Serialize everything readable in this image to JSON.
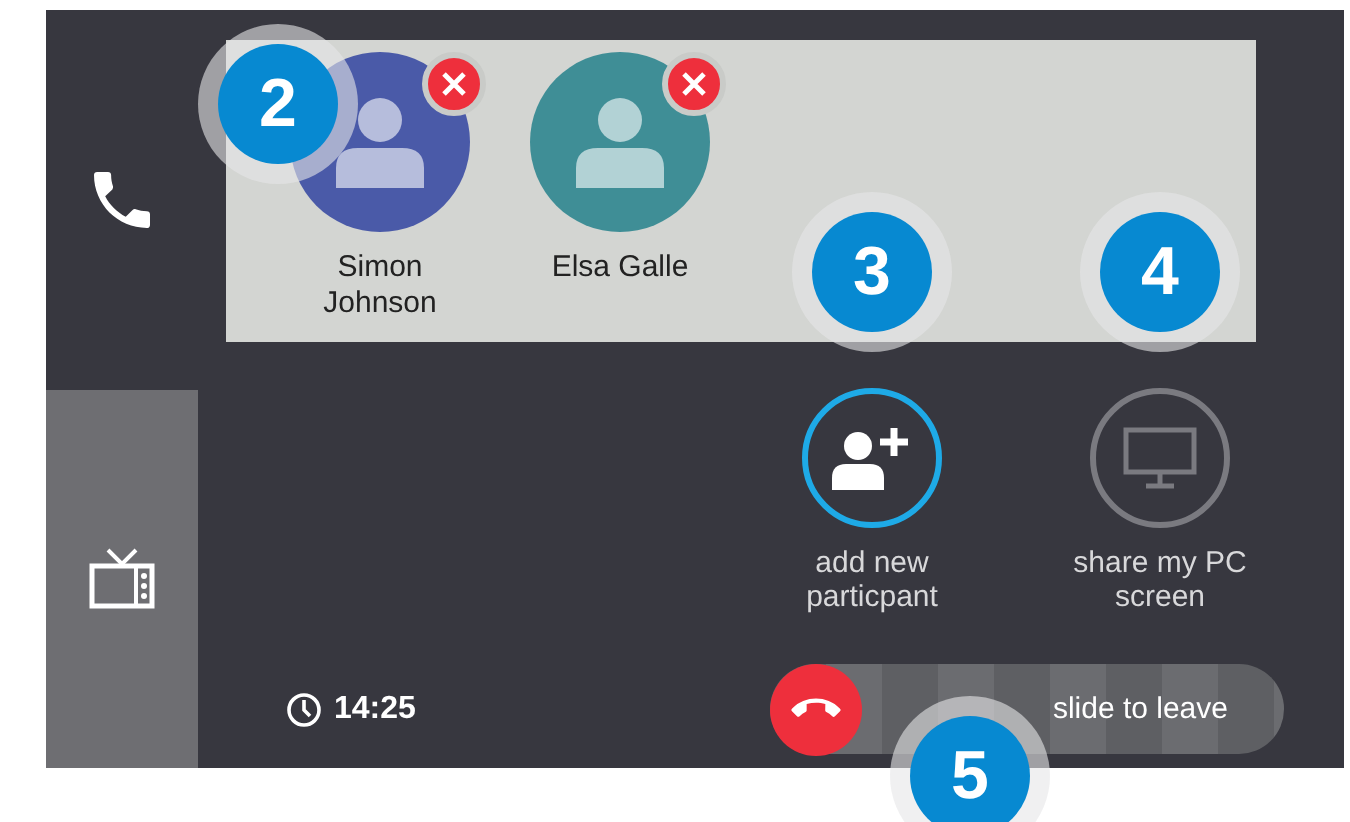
{
  "sidebar": {
    "items": [
      {
        "kind": "phone",
        "selected": false
      },
      {
        "kind": "tv",
        "selected": true
      }
    ]
  },
  "participants": [
    {
      "name": "Simon Johnson",
      "color": "#4a5aa8",
      "callout": "2"
    },
    {
      "name": "Elsa Galle",
      "color": "#3f8e96"
    }
  ],
  "actions": [
    {
      "kind": "add",
      "label": "add new particpant",
      "selected": true,
      "callout": "3"
    },
    {
      "kind": "share",
      "label": "share my PC screen",
      "selected": false,
      "callout": "4"
    }
  ],
  "clock": {
    "time": "14:25"
  },
  "leave_slider": {
    "label": "slide to leave",
    "level": 0,
    "callout": "5"
  }
}
